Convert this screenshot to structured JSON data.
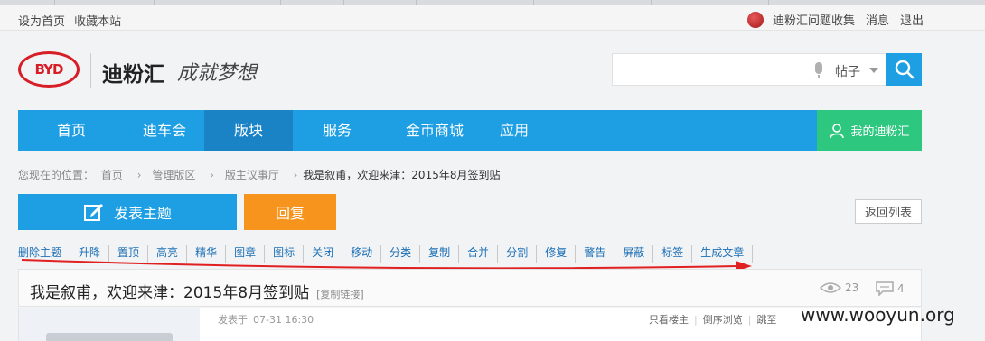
{
  "topbar": {
    "left_links": [
      "设为首页",
      "收藏本站"
    ],
    "user_name": "迪粉汇问题收集",
    "messages": "消息",
    "logout": "退出"
  },
  "header": {
    "logo_text": "BYD",
    "site_name": "迪粉汇",
    "slogan": "成就梦想",
    "search": {
      "value": "",
      "type_label": "帖子"
    }
  },
  "nav": {
    "items": [
      "首页",
      "迪车会",
      "版块",
      "服务",
      "金币商城",
      "应用"
    ],
    "active_index": 2,
    "my_label": "我的迪粉汇"
  },
  "breadcrumb": {
    "prefix": "您现在的位置：",
    "items": [
      "首页",
      "管理版区",
      "版主议事厅"
    ],
    "current": "我是叙甫，欢迎来津：2015年8月签到贴"
  },
  "actions": {
    "post_label": "发表主题",
    "reply_label": "回复",
    "back_label": "返回列表"
  },
  "moderation": [
    "删除主题",
    "升降",
    "置顶",
    "高亮",
    "精华",
    "图章",
    "图标",
    "关闭",
    "移动",
    "分类",
    "复制",
    "合并",
    "分割",
    "修复",
    "警告",
    "屏蔽",
    "标签",
    "生成文章"
  ],
  "thread": {
    "title": "我是叙甫，欢迎来津：2015年8月签到贴",
    "copy_link": "[复制链接]",
    "views": "23",
    "replies": "4"
  },
  "post": {
    "posted_prefix": "发表于",
    "posted_time": "07-31 16:30",
    "links": [
      "只看楼主",
      "倒序浏览",
      "跳至"
    ]
  },
  "watermark": "www.wooyun.org",
  "colors": {
    "primary_blue": "#1e9fe3",
    "active_blue": "#1a83c6",
    "orange": "#f7941d",
    "green": "#2ec77f",
    "brand_red": "#d71e26",
    "annotation_red": "#e02020"
  }
}
